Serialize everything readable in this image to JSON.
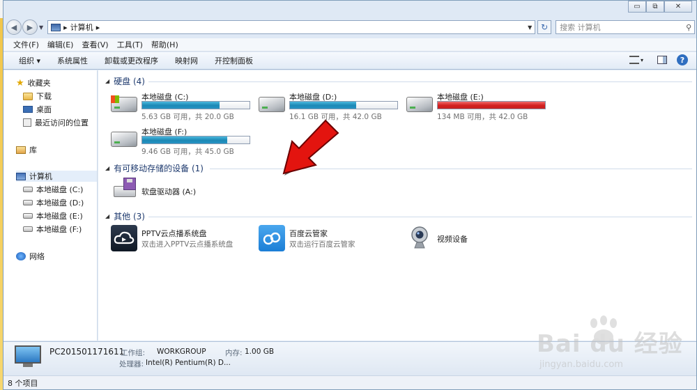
{
  "titlebar": {
    "minimize_glyph": "▭",
    "restore_glyph": "⧉",
    "close_glyph": "✕"
  },
  "address": {
    "back_glyph": "◀",
    "forward_glyph": "▶",
    "path_sep": "▸",
    "path": "计算机",
    "path_end": "▸",
    "dropdown_glyph": "▼",
    "refresh_glyph": "↻",
    "search_placeholder": "搜索 计算机",
    "search_icon_glyph": "⚲"
  },
  "menu": [
    "文件(F)",
    "编辑(E)",
    "查看(V)",
    "工具(T)",
    "帮助(H)"
  ],
  "commands": {
    "organize": "组织 ▾",
    "system_properties": "系统属性",
    "uninstall": "卸载或更改程序",
    "map_drive": "映射网",
    "control_panel": "开控制面板",
    "view_drop": "▾",
    "help": "?"
  },
  "nav": {
    "favorites": "收藏夹",
    "downloads": "下载",
    "desktop": "桌面",
    "recent": "最近访问的位置",
    "libraries": "库",
    "computer": "计算机",
    "drives": [
      "本地磁盘 (C:)",
      "本地磁盘 (D:)",
      "本地磁盘 (E:)",
      "本地磁盘 (F:)"
    ],
    "network": "网络"
  },
  "groups": {
    "hard_disks": "硬盘 (4)",
    "removable": "有可移动存储的设备 (1)",
    "other": "其他 (3)",
    "collapse_glyph": "◢"
  },
  "drives": [
    {
      "name": "本地磁盘 (C:)",
      "info": "5.63 GB 可用，共 20.0 GB",
      "used_fraction": 0.72,
      "status": "normal"
    },
    {
      "name": "本地磁盘 (D:)",
      "info": "16.1 GB 可用，共 42.0 GB",
      "used_fraction": 0.62,
      "status": "normal"
    },
    {
      "name": "本地磁盘 (E:)",
      "info": "134 MB 可用，共 42.0 GB",
      "used_fraction": 0.997,
      "status": "full"
    },
    {
      "name": "本地磁盘 (F:)",
      "info": "9.46 GB 可用，共 45.0 GB",
      "used_fraction": 0.79,
      "status": "normal"
    }
  ],
  "removable": [
    {
      "name": "软盘驱动器 (A:)"
    }
  ],
  "other": [
    {
      "name": "PPTV云点播系统盘",
      "desc": "双击进入PPTV云点播系统盘"
    },
    {
      "name": "百度云管家",
      "desc": "双击运行百度云管家"
    },
    {
      "name": "视频设备",
      "desc": ""
    }
  ],
  "details": {
    "pc_name": "PC201501171611",
    "workgroup_label": "工作组:",
    "workgroup_value": "WORKGROUP",
    "memory_label": "内存:",
    "memory_value": "1.00 GB",
    "cpu_label": "处理器:",
    "cpu_value": "Intel(R) Pentium(R) D..."
  },
  "status": {
    "item_count": "8 个项目"
  },
  "watermark": {
    "brand": "Bai  du 经验",
    "url": "jingyan.baidu.com"
  },
  "colors": {
    "bar_normal": "#1c88b5",
    "bar_full": "#d21f1f",
    "arrow": "#e3140f"
  }
}
